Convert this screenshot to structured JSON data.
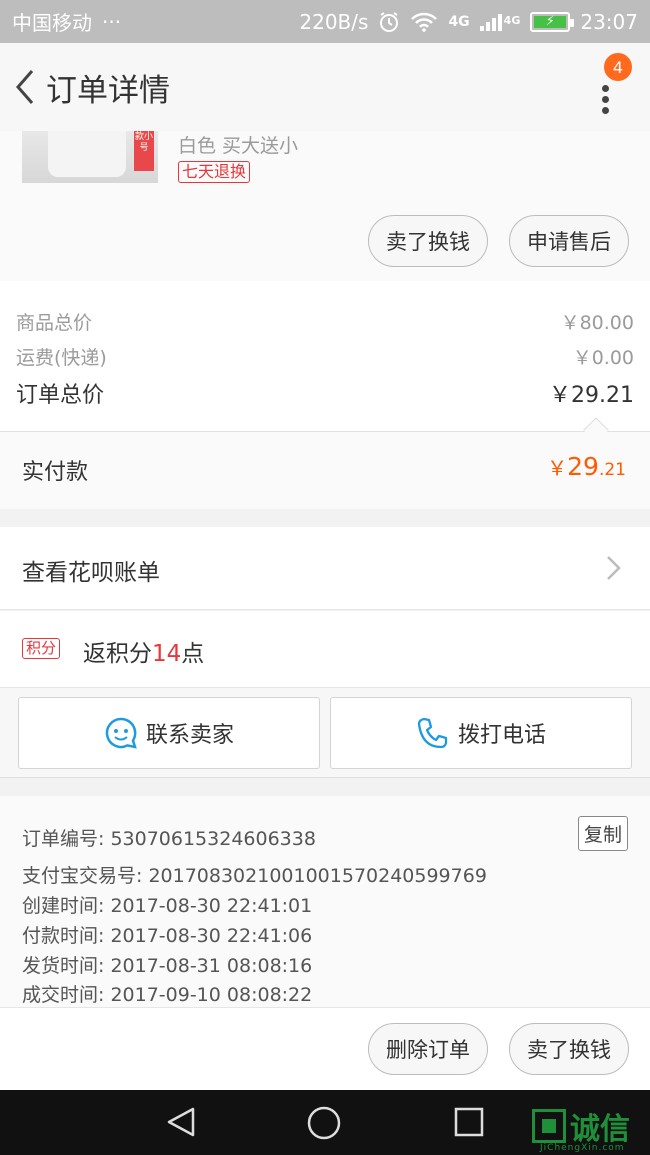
{
  "status_bar": {
    "carrier": "中国移动",
    "more": "···",
    "speed": "220B/s",
    "network": "4G",
    "network2": "4G",
    "time": "23:07"
  },
  "nav": {
    "title": "订单详情",
    "badge": "4"
  },
  "product": {
    "thumb_tag": "款小号",
    "sku": "白色 买大送小",
    "return_tag": "七天退换",
    "actions": [
      "卖了换钱",
      "申请售后"
    ]
  },
  "summary": {
    "goods_label": "商品总价",
    "goods_value": "￥80.00",
    "shipping_label": "运费(快递)",
    "shipping_value": "￥0.00",
    "total_label": "订单总价",
    "total_value": "￥29.21"
  },
  "paid": {
    "label": "实付款",
    "yen": "￥",
    "int": "29",
    "dec": ".21"
  },
  "huabei": {
    "label": "查看花呗账单"
  },
  "points": {
    "tag": "积分",
    "prefix": "返积分",
    "count": "14",
    "suffix": "点"
  },
  "contact": {
    "seller": "联系卖家",
    "call": "拨打电话"
  },
  "order_info": {
    "order_no": "订单编号: 53070615324606338",
    "copy": "复制",
    "alipay_no": "支付宝交易号: 2017083021001001570240599769",
    "created": "创建时间: 2017-08-30 22:41:01",
    "paid": "付款时间: 2017-08-30 22:41:06",
    "shipped": "发货时间: 2017-08-31 08:08:16",
    "completed": "成交时间: 2017-09-10 08:08:22"
  },
  "bottom": {
    "delete": "删除订单",
    "sell": "卖了换钱"
  },
  "watermark": {
    "text": "诚信",
    "sub": "JiChengXin.com"
  }
}
